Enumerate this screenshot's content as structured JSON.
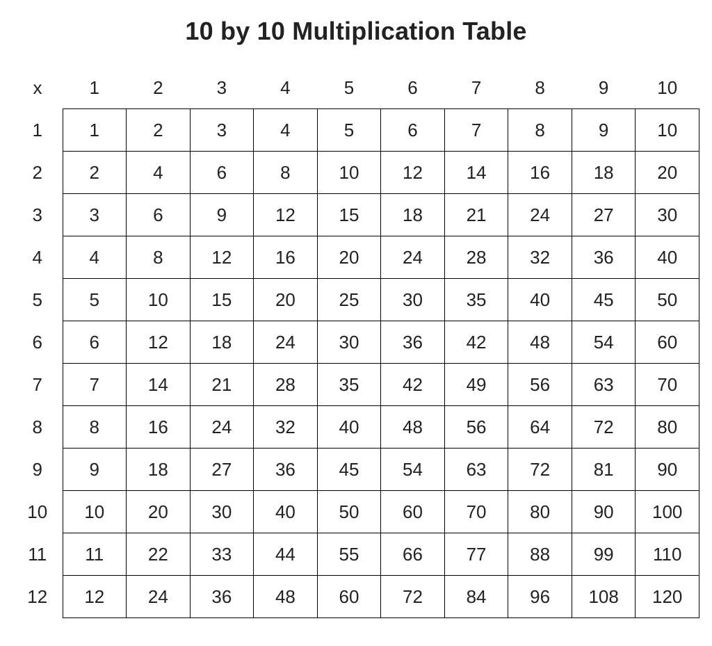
{
  "title": "10 by 10 Multiplication Table",
  "corner_label": "x",
  "columns": [
    "1",
    "2",
    "3",
    "4",
    "5",
    "6",
    "7",
    "8",
    "9",
    "10"
  ],
  "rows": [
    "1",
    "2",
    "3",
    "4",
    "5",
    "6",
    "7",
    "8",
    "9",
    "10",
    "11",
    "12"
  ],
  "chart_data": {
    "type": "table",
    "title": "10 by 10 Multiplication Table",
    "columns": [
      1,
      2,
      3,
      4,
      5,
      6,
      7,
      8,
      9,
      10
    ],
    "rows": [
      1,
      2,
      3,
      4,
      5,
      6,
      7,
      8,
      9,
      10,
      11,
      12
    ],
    "values": [
      [
        1,
        2,
        3,
        4,
        5,
        6,
        7,
        8,
        9,
        10
      ],
      [
        2,
        4,
        6,
        8,
        10,
        12,
        14,
        16,
        18,
        20
      ],
      [
        3,
        6,
        9,
        12,
        15,
        18,
        21,
        24,
        27,
        30
      ],
      [
        4,
        8,
        12,
        16,
        20,
        24,
        28,
        32,
        36,
        40
      ],
      [
        5,
        10,
        15,
        20,
        25,
        30,
        35,
        40,
        45,
        50
      ],
      [
        6,
        12,
        18,
        24,
        30,
        36,
        42,
        48,
        54,
        60
      ],
      [
        7,
        14,
        21,
        28,
        35,
        42,
        49,
        56,
        63,
        70
      ],
      [
        8,
        16,
        24,
        32,
        40,
        48,
        56,
        64,
        72,
        80
      ],
      [
        9,
        18,
        27,
        36,
        45,
        54,
        63,
        72,
        81,
        90
      ],
      [
        10,
        20,
        30,
        40,
        50,
        60,
        70,
        80,
        90,
        100
      ],
      [
        11,
        22,
        33,
        44,
        55,
        66,
        77,
        88,
        99,
        110
      ],
      [
        12,
        24,
        36,
        48,
        60,
        72,
        84,
        96,
        108,
        120
      ]
    ]
  }
}
